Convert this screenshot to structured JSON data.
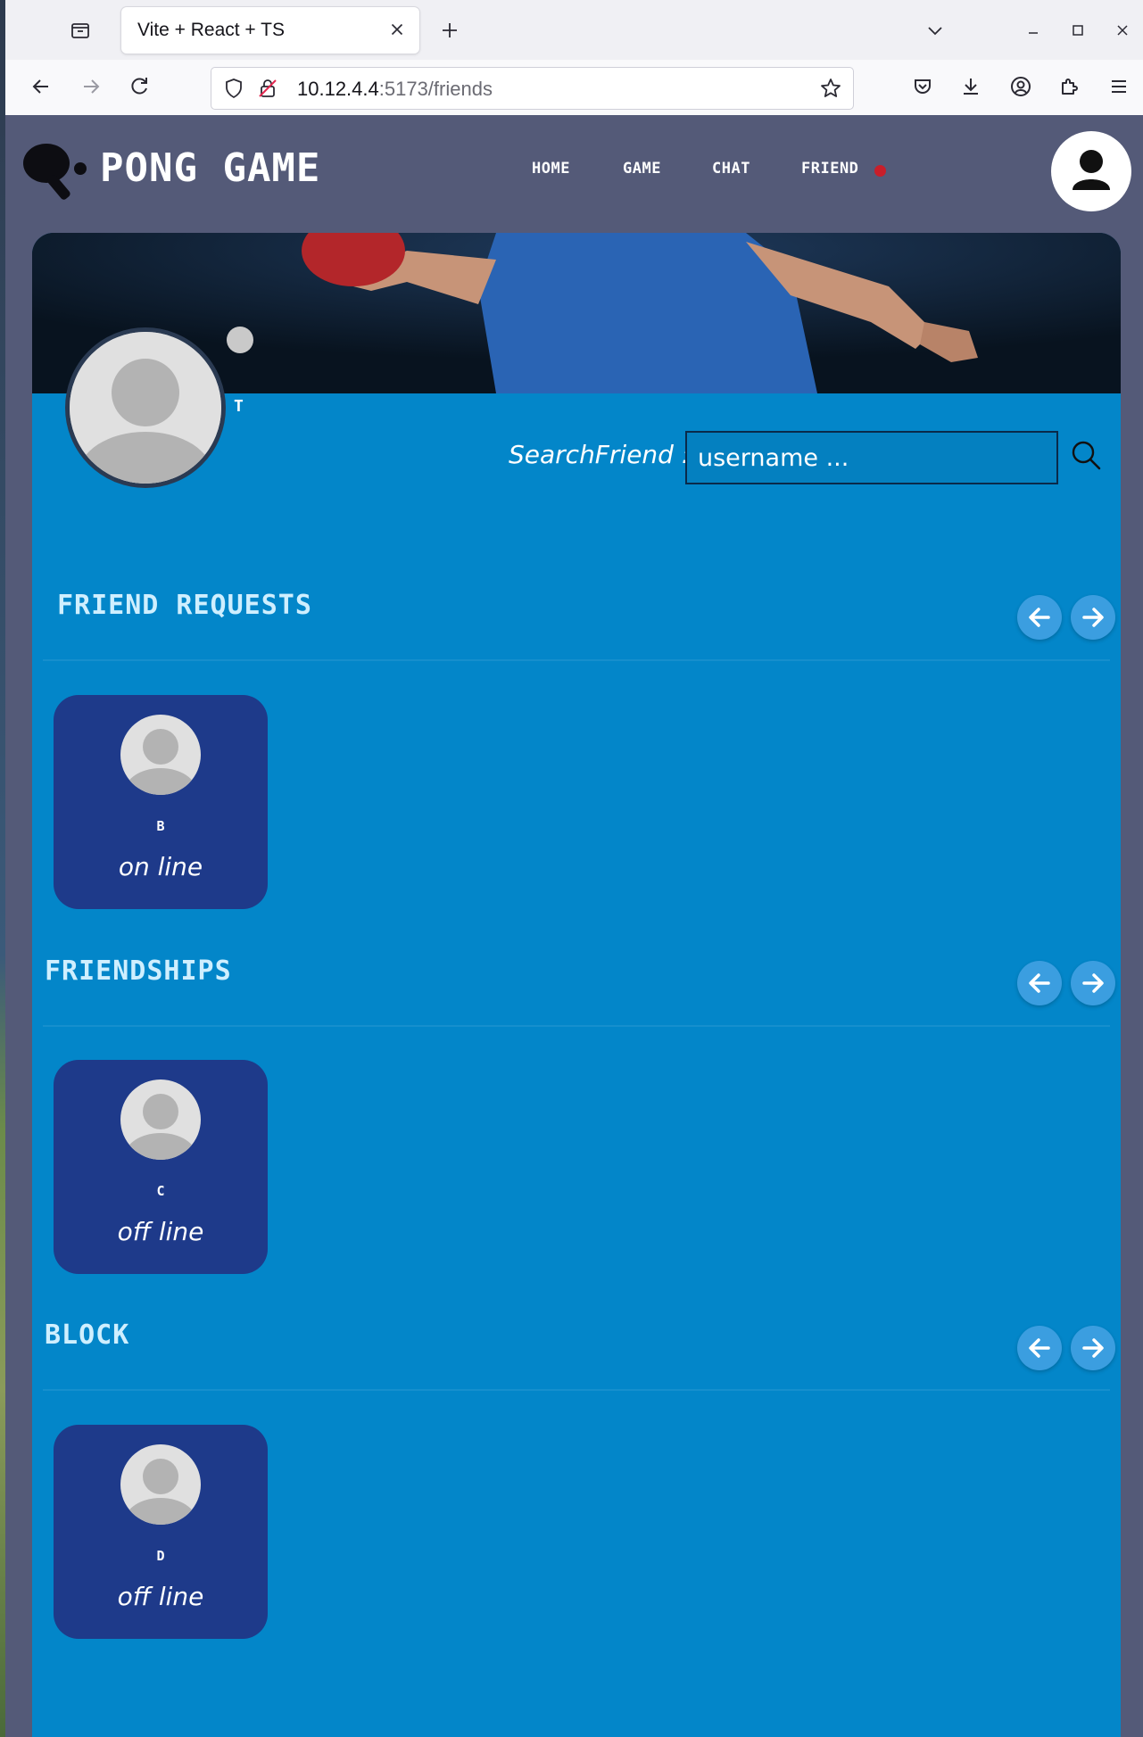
{
  "browser": {
    "tab_title": "Vite + React + TS",
    "url_host": "10.12.4.4",
    "url_rest": ":5173/friends"
  },
  "app": {
    "logo_text": "PONG GAME",
    "nav": [
      "HOME",
      "GAME",
      "CHAT",
      "FRIEND"
    ],
    "notification_color": "#c81e2a"
  },
  "profile": {
    "name": "T"
  },
  "search": {
    "label": "SearchFriend :",
    "placeholder": "username ..."
  },
  "sections": [
    {
      "title": "FRIEND REQUESTS",
      "users": [
        {
          "name": "B",
          "status": "on line"
        }
      ]
    },
    {
      "title": "FRIENDSHIPS",
      "users": [
        {
          "name": "C",
          "status": "off line"
        }
      ]
    },
    {
      "title": "BLOCK",
      "users": [
        {
          "name": "D",
          "status": "off line"
        }
      ]
    }
  ],
  "colors": {
    "app_bg": "#545a78",
    "content_bg": "#0386c9",
    "user_card_bg": "#1e3a8a",
    "arrow_button_bg": "#3b9ee0"
  }
}
